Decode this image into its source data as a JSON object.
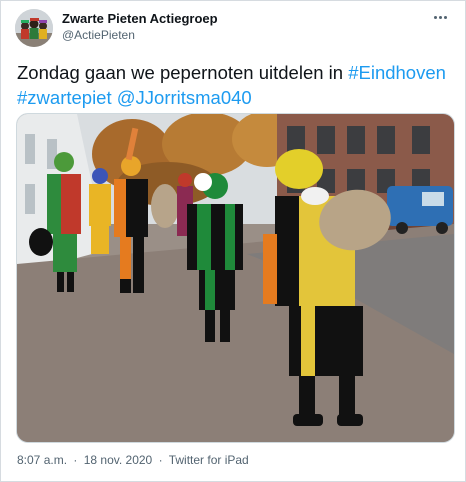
{
  "tweet": {
    "display_name": "Zwarte Pieten Actiegroep",
    "handle": "@ActiePieten",
    "text_plain": "Zondag gaan we pepernoten uitdelen in",
    "hashtag_1": "#Eindhoven",
    "hashtag_2": "#zwartepiet",
    "mention": "@JJorritsma040",
    "time": "8:07 a.m.",
    "separator": "·",
    "date": "18 nov. 2020",
    "source": "Twitter for iPad"
  },
  "icons": {
    "more": "more-horizontal-icon",
    "avatar": "avatar-image"
  },
  "colors": {
    "link": "#1d9bf0",
    "text": "#0f1419",
    "secondary": "#536471",
    "border": "#cfd9de"
  }
}
